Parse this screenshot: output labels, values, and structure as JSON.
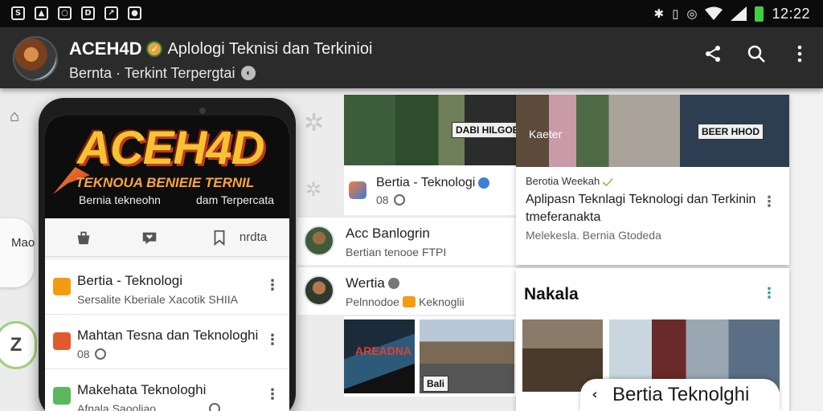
{
  "status_bar": {
    "left_icons": [
      "S",
      "image",
      "circle",
      "D",
      "chart",
      "shield"
    ],
    "time": "12:22",
    "icons": [
      "bluetooth-icon",
      "vibrate-icon",
      "wifi-icon",
      "signal-icon",
      "battery-icon"
    ]
  },
  "app_bar": {
    "brand": "ACEH4D",
    "tagline": "Aplologi Teknisi dan Terkinioi",
    "subtitle": "Bernta · Terkint  Terpergtai",
    "actions": [
      "share-icon",
      "search-icon",
      "more-vert-icon"
    ]
  },
  "left_rail": {
    "text": "Mao DQ · iair",
    "badge": "Z"
  },
  "phone": {
    "hero": {
      "logo": "ACEH4D",
      "slogan": "TEKNOUA BENIEIE TERNIL",
      "sub_left": "Bernia tekneohn",
      "sub_right": "dam Terpercata"
    },
    "tabs": {
      "tab_label": "nrdta"
    },
    "list": [
      {
        "title": "Bertia - Teknologi",
        "subtitle": "Sersalite Kberiale Xacotik SHIIA",
        "icon_color": "#f39c12"
      },
      {
        "title": "Mahtan Tesna dan Teknologhi",
        "subtitle": "08",
        "icon_color": "#e05a2b"
      },
      {
        "title": "Makehata Teknologhi",
        "subtitle": "Afnala Saooliao",
        "icon_color": "#5cb85c"
      }
    ]
  },
  "feed": {
    "top_card": {
      "image_label": "DABI HILGOE",
      "title": "Bertia - Teknologi",
      "meta": "08"
    },
    "rows": [
      {
        "title": "Acc Banlogrin",
        "subtitle": "Bertian tenooe FTPI"
      },
      {
        "title": "Wertia",
        "subtitle_prefix": "Pelnnodoe",
        "subtitle_suffix": "Keknoglii"
      }
    ],
    "thumbs": [
      {
        "label": "AREADNA"
      },
      {
        "label": "Bali"
      }
    ]
  },
  "right_card": {
    "image_labels": [
      "Kaeter",
      "BEER HHOD"
    ],
    "category": "Berotia Weekah",
    "title": "Aplipasn Teknlagi Teknologi dan Terkinin tmeferanakta",
    "meta": "Melekesla. Bernia Gtodeda"
  },
  "right_card_2": {
    "heading": "Nakala"
  },
  "bottom_pill": {
    "chevron": "‹",
    "text": "Bertia Teknolghi"
  }
}
